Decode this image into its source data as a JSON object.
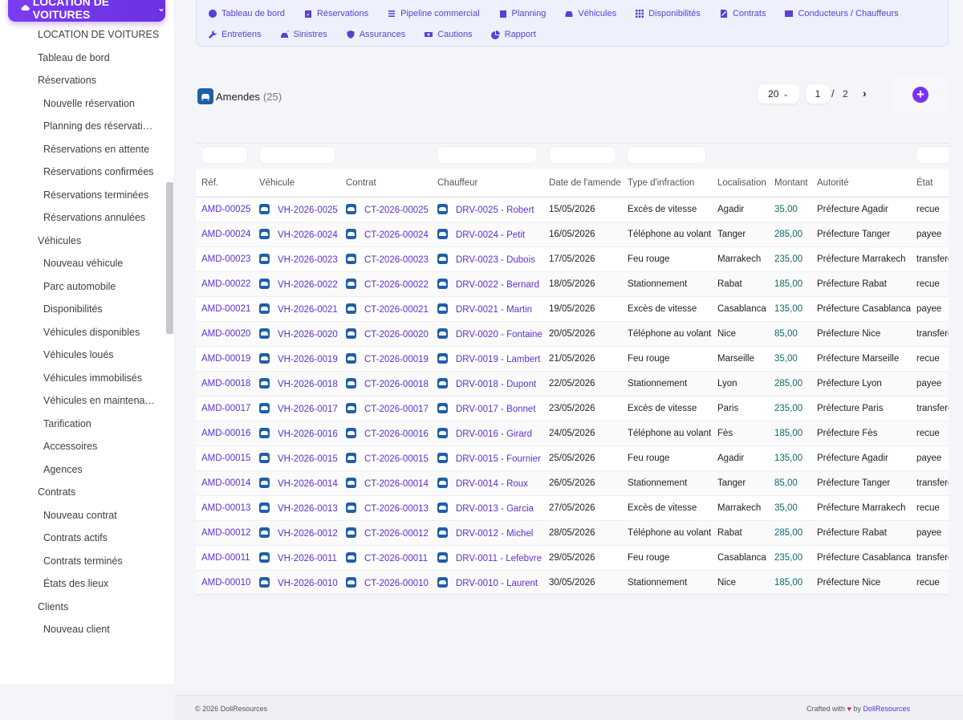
{
  "module": {
    "label": "LOCATION DE VOITURES"
  },
  "sidebar": {
    "items": [
      {
        "label": "LOCATION DE VOITURES",
        "level": 0
      },
      {
        "label": "Tableau de bord",
        "level": 0
      },
      {
        "label": "Réservations",
        "level": 0
      },
      {
        "label": "Nouvelle réservation",
        "level": 1
      },
      {
        "label": "Planning des réservations",
        "level": 1
      },
      {
        "label": "Réservations en attente",
        "level": 1
      },
      {
        "label": "Réservations confirmées",
        "level": 1
      },
      {
        "label": "Réservations terminées",
        "level": 1
      },
      {
        "label": "Réservations annulées",
        "level": 1
      },
      {
        "label": "Véhicules",
        "level": 0
      },
      {
        "label": "Nouveau véhicule",
        "level": 1
      },
      {
        "label": "Parc automobile",
        "level": 1
      },
      {
        "label": "Disponibilités",
        "level": 1
      },
      {
        "label": "Véhicules disponibles",
        "level": 1
      },
      {
        "label": "Véhicules loués",
        "level": 1
      },
      {
        "label": "Véhicules immobilisés",
        "level": 1
      },
      {
        "label": "Véhicules en maintenance",
        "level": 1
      },
      {
        "label": "Tarification",
        "level": 1
      },
      {
        "label": "Accessoires",
        "level": 1
      },
      {
        "label": "Agences",
        "level": 1
      },
      {
        "label": "Contrats",
        "level": 0
      },
      {
        "label": "Nouveau contrat",
        "level": 1
      },
      {
        "label": "Contrats actifs",
        "level": 1
      },
      {
        "label": "Contrats terminés",
        "level": 1
      },
      {
        "label": "États des lieux",
        "level": 1
      },
      {
        "label": "Clients",
        "level": 0
      },
      {
        "label": "Nouveau client",
        "level": 1
      }
    ]
  },
  "topnav": {
    "row1": [
      {
        "label": "Tableau de bord",
        "icon": "dashboard-icon"
      },
      {
        "label": "Réservations",
        "icon": "calendar-check-icon"
      },
      {
        "label": "Pipeline commercial",
        "icon": "list-icon"
      },
      {
        "label": "Planning",
        "icon": "calendar-icon"
      },
      {
        "label": "Véhicules",
        "icon": "car-icon"
      },
      {
        "label": "Disponibilités",
        "icon": "grid-icon"
      },
      {
        "label": "Contrats",
        "icon": "signature-icon"
      },
      {
        "label": "Conducteurs / Chauffeurs",
        "icon": "id-card-icon"
      }
    ],
    "row2": [
      {
        "label": "Entretiens",
        "icon": "wrench-icon"
      },
      {
        "label": "Sinistres",
        "icon": "car-crash-icon"
      },
      {
        "label": "Assurances",
        "icon": "shield-icon"
      },
      {
        "label": "Cautions",
        "icon": "money-icon"
      },
      {
        "label": "Rapport",
        "icon": "pie-chart-icon"
      }
    ]
  },
  "list": {
    "title": "Amendes",
    "count": "(25)",
    "limit": "20",
    "page": "1",
    "page_sep": "/",
    "total_pages": "2",
    "next": "›",
    "add": "+"
  },
  "table": {
    "headers": [
      "Réf.",
      "Véhicule",
      "Contrat",
      "Chauffeur",
      "Date de l'amende",
      "Type d'infraction",
      "Localisation",
      "Montant",
      "Autorité",
      "État"
    ],
    "rows": [
      [
        "AMD-00025",
        "VH-2026-0025",
        "CT-2026-00025",
        "DRV-0025 - Robert",
        "15/05/2026",
        "Excès de vitesse",
        "Agadir",
        "35,00",
        "Préfecture Agadir",
        "recue"
      ],
      [
        "AMD-00024",
        "VH-2026-0024",
        "CT-2026-00024",
        "DRV-0024 - Petit",
        "16/05/2026",
        "Téléphone au volant",
        "Tanger",
        "285,00",
        "Préfecture Tanger",
        "payee"
      ],
      [
        "AMD-00023",
        "VH-2026-0023",
        "CT-2026-00023",
        "DRV-0023 - Dubois",
        "17/05/2026",
        "Feu rouge",
        "Marrakech",
        "235,00",
        "Préfecture Marrakech",
        "transferee"
      ],
      [
        "AMD-00022",
        "VH-2026-0022",
        "CT-2026-00022",
        "DRV-0022 - Bernard",
        "18/05/2026",
        "Stationnement",
        "Rabat",
        "185,00",
        "Préfecture Rabat",
        "recue"
      ],
      [
        "AMD-00021",
        "VH-2026-0021",
        "CT-2026-00021",
        "DRV-0021 - Martin",
        "19/05/2026",
        "Excès de vitesse",
        "Casablanca",
        "135,00",
        "Préfecture Casablanca",
        "payee"
      ],
      [
        "AMD-00020",
        "VH-2026-0020",
        "CT-2026-00020",
        "DRV-0020 - Fontaine",
        "20/05/2026",
        "Téléphone au volant",
        "Nice",
        "85,00",
        "Préfecture Nice",
        "transferee"
      ],
      [
        "AMD-00019",
        "VH-2026-0019",
        "CT-2026-00019",
        "DRV-0019 - Lambert",
        "21/05/2026",
        "Feu rouge",
        "Marseille",
        "35,00",
        "Préfecture Marseille",
        "recue"
      ],
      [
        "AMD-00018",
        "VH-2026-0018",
        "CT-2026-00018",
        "DRV-0018 - Dupont",
        "22/05/2026",
        "Stationnement",
        "Lyon",
        "285,00",
        "Préfecture Lyon",
        "payee"
      ],
      [
        "AMD-00017",
        "VH-2026-0017",
        "CT-2026-00017",
        "DRV-0017 - Bonnet",
        "23/05/2026",
        "Excès de vitesse",
        "Paris",
        "235,00",
        "Préfecture Paris",
        "transferee"
      ],
      [
        "AMD-00016",
        "VH-2026-0016",
        "CT-2026-00016",
        "DRV-0016 - Girard",
        "24/05/2026",
        "Téléphone au volant",
        "Fès",
        "185,00",
        "Préfecture Fès",
        "recue"
      ],
      [
        "AMD-00015",
        "VH-2026-0015",
        "CT-2026-00015",
        "DRV-0015 - Fournier",
        "25/05/2026",
        "Feu rouge",
        "Agadir",
        "135,00",
        "Préfecture Agadir",
        "payee"
      ],
      [
        "AMD-00014",
        "VH-2026-0014",
        "CT-2026-00014",
        "DRV-0014 - Roux",
        "26/05/2026",
        "Stationnement",
        "Tanger",
        "85,00",
        "Préfecture Tanger",
        "transferee"
      ],
      [
        "AMD-00013",
        "VH-2026-0013",
        "CT-2026-00013",
        "DRV-0013 - Garcia",
        "27/05/2026",
        "Excès de vitesse",
        "Marrakech",
        "35,00",
        "Préfecture Marrakech",
        "recue"
      ],
      [
        "AMD-00012",
        "VH-2026-0012",
        "CT-2026-00012",
        "DRV-0012 - Michel",
        "28/05/2026",
        "Téléphone au volant",
        "Rabat",
        "285,00",
        "Préfecture Rabat",
        "payee"
      ],
      [
        "AMD-00011",
        "VH-2026-0011",
        "CT-2026-00011",
        "DRV-0011 - Lefebvre",
        "29/05/2026",
        "Feu rouge",
        "Casablanca",
        "235,00",
        "Préfecture Casablanca",
        "transferee"
      ],
      [
        "AMD-00010",
        "VH-2026-0010",
        "CT-2026-00010",
        "DRV-0010 - Laurent",
        "30/05/2026",
        "Stationnement",
        "Nice",
        "185,00",
        "Préfecture Nice",
        "recue"
      ]
    ]
  },
  "footer": {
    "copyright": "© 2026 DoliResources",
    "crafted_prefix": "Crafted with",
    "crafted_by": "by",
    "brand": "DoliResources"
  },
  "colors": {
    "accent": "#7a3cf2",
    "link": "#5b2fd6",
    "amount": "#0d6b66",
    "icon_blue": "#1f5fa8"
  }
}
